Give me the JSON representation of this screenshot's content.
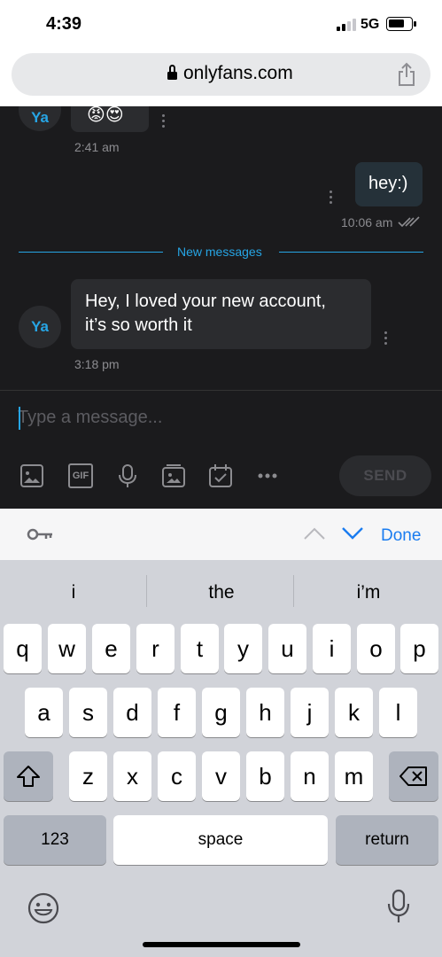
{
  "status": {
    "time": "4:39",
    "network": "5G"
  },
  "browser": {
    "url": "onlyfans.com"
  },
  "chat": {
    "messages": [
      {
        "avatar": "Ya",
        "content": "😡😍",
        "time": "2:41 am"
      },
      {
        "text": "hey:)",
        "time": "10:06 am"
      },
      {
        "avatar": "Ya",
        "text_line1": "Hey, I loved your new account,",
        "text_line2": "it’s so worth it",
        "time": "3:18 pm"
      }
    ],
    "divider": "New messages"
  },
  "composer": {
    "placeholder": "Type a message...",
    "send": "SEND",
    "gif_label": "GIF"
  },
  "accessory": {
    "done": "Done"
  },
  "keyboard": {
    "suggestions": [
      "i",
      "the",
      "i’m"
    ],
    "row1": [
      "q",
      "w",
      "e",
      "r",
      "t",
      "y",
      "u",
      "i",
      "o",
      "p"
    ],
    "row2": [
      "a",
      "s",
      "d",
      "f",
      "g",
      "h",
      "j",
      "k",
      "l"
    ],
    "row3": [
      "z",
      "x",
      "c",
      "v",
      "b",
      "n",
      "m"
    ],
    "numbers": "123",
    "space": "space",
    "return": "return"
  },
  "colors": {
    "accent": "#26a5e5",
    "chat_bg": "#1b1b1d",
    "done": "#1a7cf0"
  }
}
